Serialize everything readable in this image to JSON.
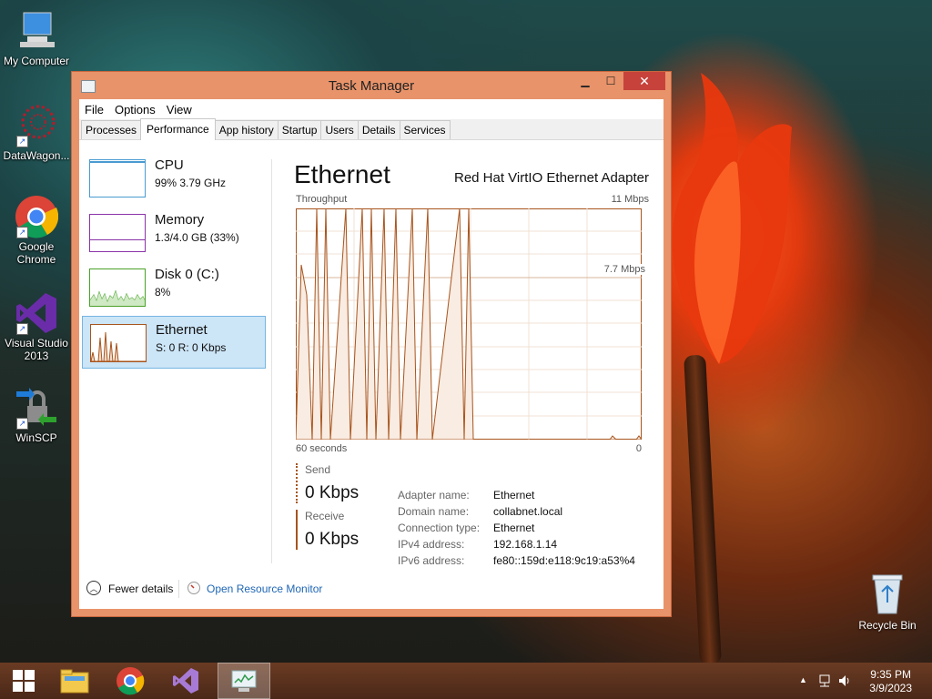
{
  "desktop": {
    "icons": [
      {
        "label": "My Computer"
      },
      {
        "label": "DataWagon..."
      },
      {
        "label": "Google Chrome"
      },
      {
        "label": "Visual Studio 2013"
      },
      {
        "label": "WinSCP"
      }
    ],
    "recycle_bin": {
      "label": "Recycle Bin"
    }
  },
  "window": {
    "title": "Task Manager",
    "menu": [
      "File",
      "Options",
      "View"
    ],
    "tabs": [
      "Processes",
      "Performance",
      "App history",
      "Startup",
      "Users",
      "Details",
      "Services"
    ],
    "active_tab": "Performance"
  },
  "resources": [
    {
      "name": "CPU",
      "value": "99% 3.79 GHz",
      "color": "#4a9bd1"
    },
    {
      "name": "Memory",
      "value": "1.3/4.0 GB (33%)",
      "color": "#8b33a8"
    },
    {
      "name": "Disk 0 (C:)",
      "value": "8%",
      "color": "#4aa22a"
    },
    {
      "name": "Ethernet",
      "value": "S: 0 R: 0 Kbps",
      "color": "#a7541d"
    }
  ],
  "detail": {
    "title": "Ethernet",
    "adapter": "Red Hat VirtIO Ethernet Adapter",
    "graph_label": "Throughput",
    "graph_max": "11 Mbps",
    "graph_mid": "7.7 Mbps",
    "time_span": "60 seconds",
    "graph_min": "0",
    "send_label": "Send",
    "send_value": "0 Kbps",
    "receive_label": "Receive",
    "receive_value": "0 Kbps",
    "properties": [
      {
        "key": "Adapter name:",
        "value": "Ethernet"
      },
      {
        "key": "Domain name:",
        "value": "collabnet.local"
      },
      {
        "key": "Connection type:",
        "value": "Ethernet"
      },
      {
        "key": "IPv4 address:",
        "value": "192.168.1.14"
      },
      {
        "key": "IPv6 address:",
        "value": "fe80::159d:e118:9c19:a53%4"
      }
    ]
  },
  "footer": {
    "fewer_details": "Fewer details",
    "open_resource_monitor": "Open Resource Monitor"
  },
  "taskbar": {
    "time": "9:35 PM",
    "date": "3/9/2023"
  },
  "colors": {
    "accent_ethernet": "#a7541d",
    "window_frame": "#e8936a",
    "close_button": "#c7423b",
    "selection": "#cce5f7",
    "link": "#1e66b4"
  }
}
